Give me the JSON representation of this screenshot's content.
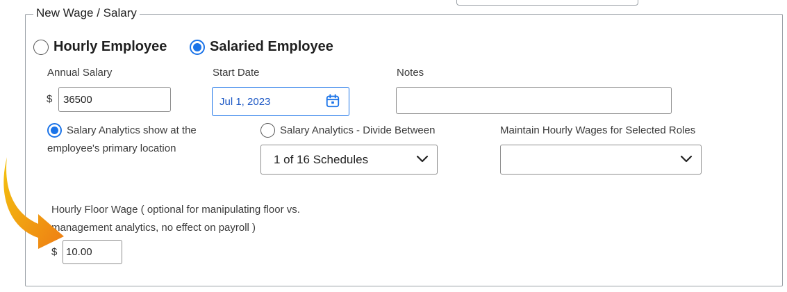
{
  "legend": "New Wage / Salary",
  "employee_type": {
    "hourly_label": "Hourly Employee",
    "salaried_label": "Salaried Employee",
    "selected": "salaried"
  },
  "annual_salary": {
    "label": "Annual Salary",
    "currency": "$",
    "value": "36500"
  },
  "start_date": {
    "label": "Start Date",
    "value": "Jul 1, 2023"
  },
  "notes": {
    "label": "Notes",
    "value": ""
  },
  "analytics": {
    "primary_label_line1": "Salary Analytics show at the",
    "primary_label_line2": "employee's primary location",
    "divide_label": "Salary Analytics - Divide Between",
    "schedules_value": "1 of 16 Schedules",
    "maintain_label": "Maintain Hourly Wages for Selected Roles",
    "maintain_value": ""
  },
  "floor_wage": {
    "label_line1": "Hourly Floor Wage ( optional for manipulating floor vs.",
    "label_line2": "management analytics, no effect on payroll )",
    "currency": "$",
    "value": "10.00"
  },
  "colors": {
    "accent": "#1a73e8",
    "arrow_start": "#f4c30f",
    "arrow_end": "#ee7d14"
  }
}
